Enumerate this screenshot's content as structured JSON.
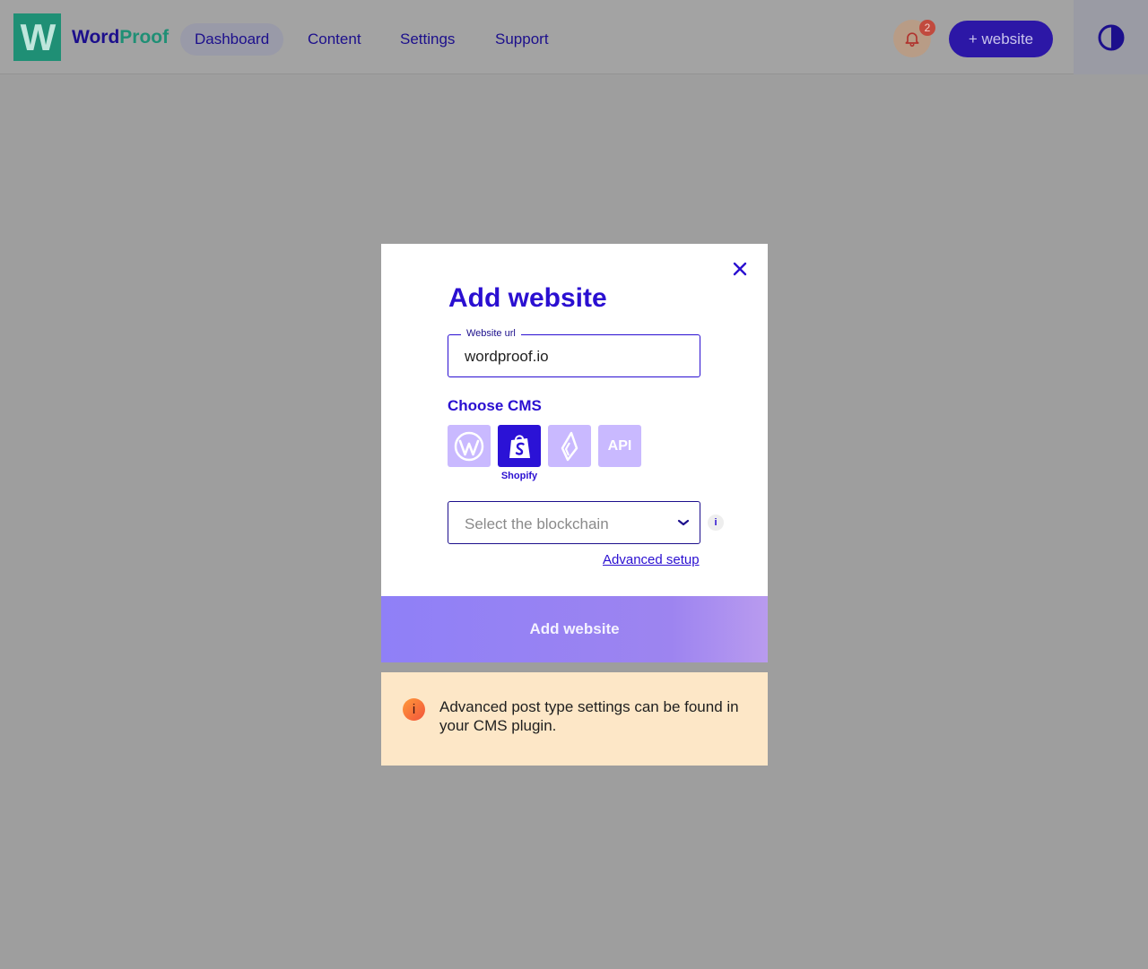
{
  "header": {
    "logo_letter": "W",
    "brand_part1": "Word",
    "brand_part2": "Proof",
    "nav": {
      "dashboard": "Dashboard",
      "content": "Content",
      "settings": "Settings",
      "support": "Support"
    },
    "notification_count": "2",
    "add_website_button": "+ website"
  },
  "modal": {
    "title": "Add website",
    "url_field": {
      "label": "Website url",
      "value": "wordproof.io"
    },
    "cms": {
      "label": "Choose CMS",
      "options": [
        {
          "name": "wordpress-icon"
        },
        {
          "name": "shopify-icon",
          "caption": "Shopify",
          "selected": true
        },
        {
          "name": "lightspeed-icon"
        },
        {
          "name": "api",
          "label": "API"
        }
      ]
    },
    "blockchain_select": {
      "placeholder": "Select the blockchain"
    },
    "info_label": "i",
    "advanced_link": "Advanced setup",
    "submit_button": "Add website"
  },
  "notice": {
    "icon_label": "i",
    "text": "Advanced post type settings can be found in your CMS plugin."
  },
  "colors": {
    "primary": "#2a0fd1",
    "brand_green": "#1f8f75",
    "cms_unselected": "#c9b9ff",
    "notice_bg": "#fde7c7",
    "overlay": "#9e9e9e"
  }
}
